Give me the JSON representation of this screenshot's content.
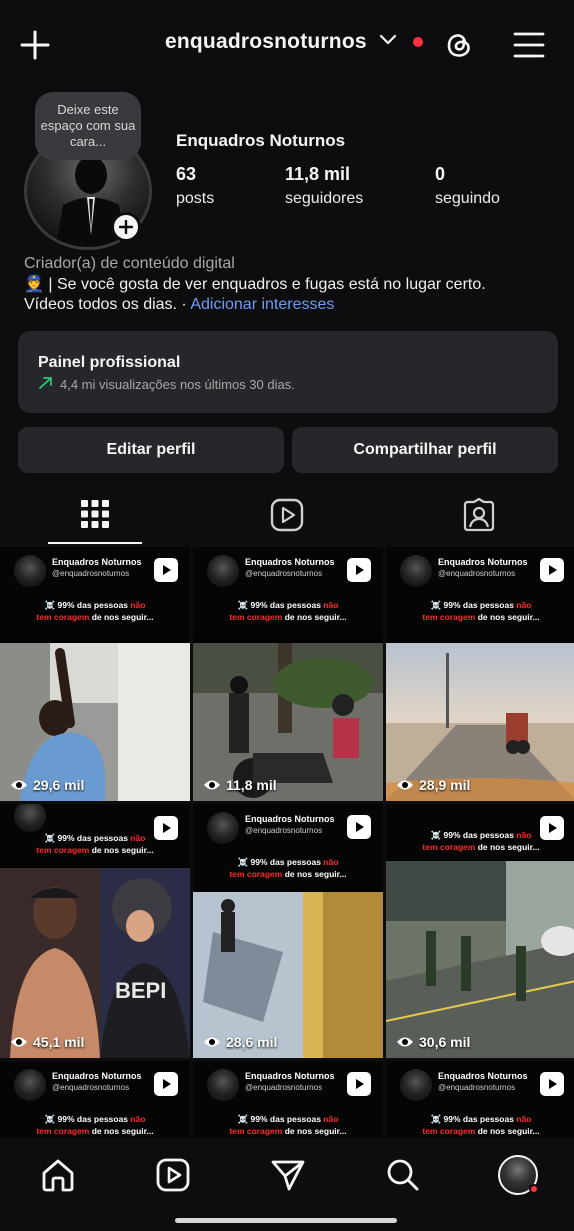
{
  "header": {
    "username": "enquadrosnoturnos",
    "icons": {
      "create": "plus-icon",
      "dropdown": "chevron-down-icon",
      "threads": "threads-icon",
      "menu": "hamburger-menu-icon"
    }
  },
  "profile": {
    "note": "Deixe este espaço com sua cara...",
    "display_name": "Enquadros Noturnos",
    "stats": {
      "posts": {
        "value": "63",
        "label": "posts"
      },
      "followers": {
        "value": "11,8 mil",
        "label": "seguidores"
      },
      "following": {
        "value": "0",
        "label": "seguindo"
      }
    },
    "category": "Criador(a) de conteúdo digital",
    "bio_line1": "👮 | Se você gosta de ver enquadros e fugas está no lugar certo.",
    "bio_line2": "Vídeos todos os dias. · ",
    "bio_link": "Adicionar interesses"
  },
  "dashboard": {
    "title": "Painel profissional",
    "subtitle": "4,4 mi visualizações nos últimos 30 dias.",
    "trend_color": "#33c37a"
  },
  "buttons": {
    "edit": "Editar perfil",
    "share": "Compartilhar perfil"
  },
  "tabs": [
    "grid-icon",
    "reels-icon",
    "tagged-icon"
  ],
  "post_overlay": {
    "name": "Enquadros Noturnos",
    "handle": "@enquadrosnoturnos",
    "line1": "☠️ 99% das pessoas ",
    "red1": "não",
    "red2": "tem coragem",
    "line2_rest": " de nos seguir..."
  },
  "posts": [
    {
      "views": "29,6 mil"
    },
    {
      "views": "11,8 mil"
    },
    {
      "views": "28,9 mil"
    },
    {
      "views": "45,1 mil"
    },
    {
      "views": "28,6 mil"
    },
    {
      "views": "30,6 mil"
    }
  ],
  "watermarks": [
    "@enquadrosnoturnos"
  ],
  "nav": [
    "home-icon",
    "reels-icon",
    "send-icon",
    "search-icon",
    "profile-avatar"
  ],
  "colors": {
    "background": "#0d0d10",
    "card": "#26272b",
    "accent_blue": "#6f9cf0",
    "notification_red": "#ff3040"
  }
}
